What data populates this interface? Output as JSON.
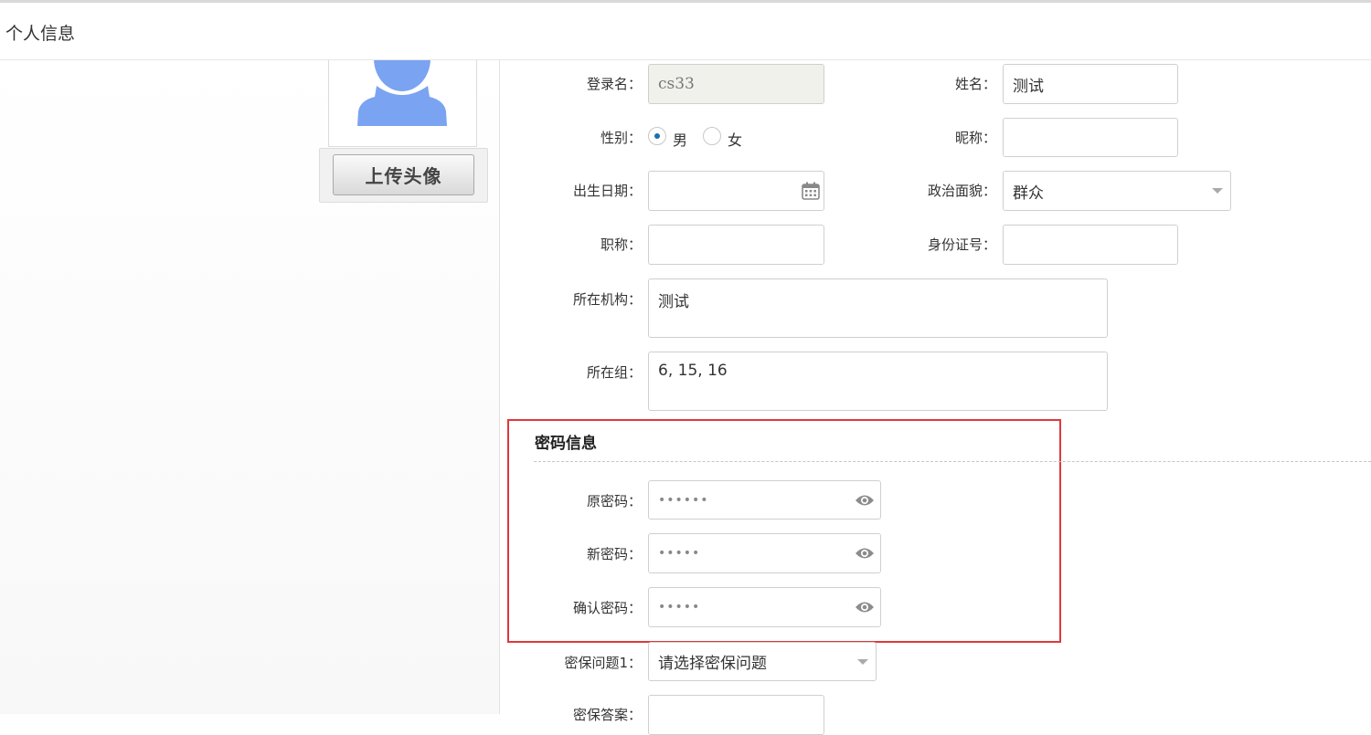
{
  "header": {
    "title": "个人信息"
  },
  "avatar": {
    "upload_label": "上传头像"
  },
  "form": {
    "login_label": "登录名：",
    "login_value": "cs33",
    "name_label": "姓名：",
    "name_value": "测试",
    "gender_label": "性别：",
    "gender_options": [
      "男",
      "女"
    ],
    "gender_selected": "男",
    "nickname_label": "昵称：",
    "nickname_value": "",
    "birth_label": "出生日期：",
    "birth_value": "",
    "political_label": "政治面貌：",
    "political_value": "群众",
    "jobtitle_label": "职称：",
    "jobtitle_value": "",
    "idcard_label": "身份证号：",
    "idcard_value": "",
    "org_label": "所在机构：",
    "org_value": "测试",
    "group_label": "所在组：",
    "group_value": "6, 15, 16"
  },
  "password": {
    "section_title": "密码信息",
    "old_label": "原密码：",
    "old_mask": "••••••",
    "new_label": "新密码：",
    "new_mask": "•••••",
    "confirm_label": "确认密码：",
    "confirm_mask": "•••••"
  },
  "security": {
    "q1_label": "密保问题1：",
    "q1_value": "请选择密保问题",
    "answer_label": "密保答案："
  },
  "colors": {
    "highlight_border": "#e0383b",
    "radio_dot": "#1a6fb0",
    "avatar_silhouette": "#7aa3f2"
  }
}
